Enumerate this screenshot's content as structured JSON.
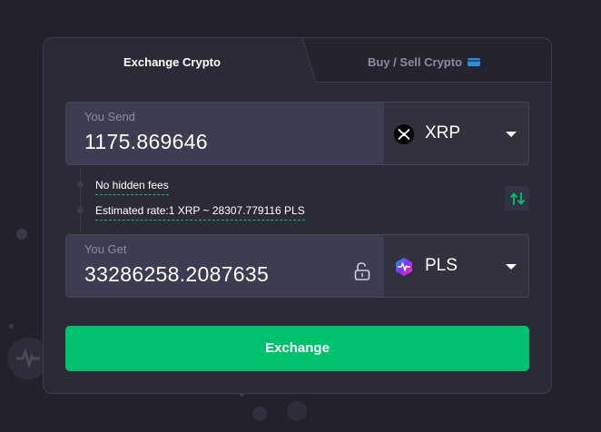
{
  "tabs": {
    "exchange_label": "Exchange Crypto",
    "buy_sell_label": "Buy / Sell Crypto"
  },
  "send": {
    "label": "You Send",
    "amount": "1175.869646",
    "currency": "XRP",
    "currency_icon": "xrp-icon"
  },
  "info": {
    "fees_text": "No hidden fees",
    "rate_text": "Estimated rate:1 XRP ~ 28307.779116 PLS"
  },
  "get": {
    "label": "You Get",
    "amount": "33286258.2087635",
    "currency": "PLS",
    "currency_icon": "pls-icon"
  },
  "actions": {
    "exchange_label": "Exchange"
  },
  "colors": {
    "accent": "#00c26e",
    "background": "#22222d",
    "card": "#2b2b38"
  }
}
